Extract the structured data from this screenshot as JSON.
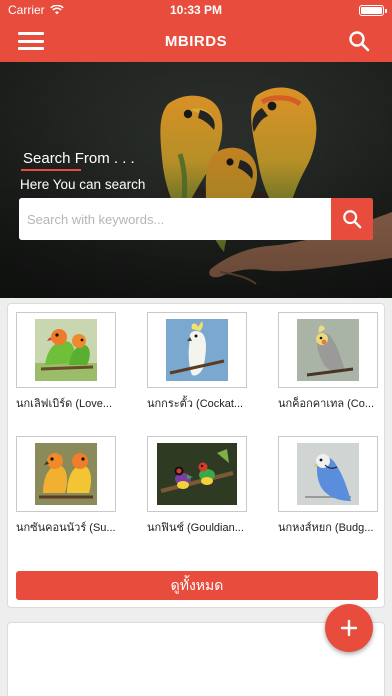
{
  "status_bar": {
    "carrier": "Carrier",
    "time": "10:33 PM"
  },
  "header": {
    "title": "MBIRDS"
  },
  "hero": {
    "title": "Search From . . .",
    "subtitle": "Here You can search",
    "search_placeholder": "Search with keywords..."
  },
  "birds": [
    {
      "label": "นกเลิฟเบิร์ด (Love..."
    },
    {
      "label": "นกกระตั้ว (Cockat..."
    },
    {
      "label": "นกค็อกคาเทล (Co..."
    },
    {
      "label": "นกซันคอนนัวร์ (Su..."
    },
    {
      "label": "นกฟินช์ (Gouldian..."
    },
    {
      "label": "นกหงส์หยก (Budg..."
    }
  ],
  "view_all_label": "ดูทั้งหมด",
  "colors": {
    "accent": "#e74c3c"
  },
  "icons": {
    "menu": "hamburger-icon",
    "search": "search-icon",
    "add": "plus-icon",
    "wifi": "wifi-icon",
    "battery": "battery-icon"
  }
}
